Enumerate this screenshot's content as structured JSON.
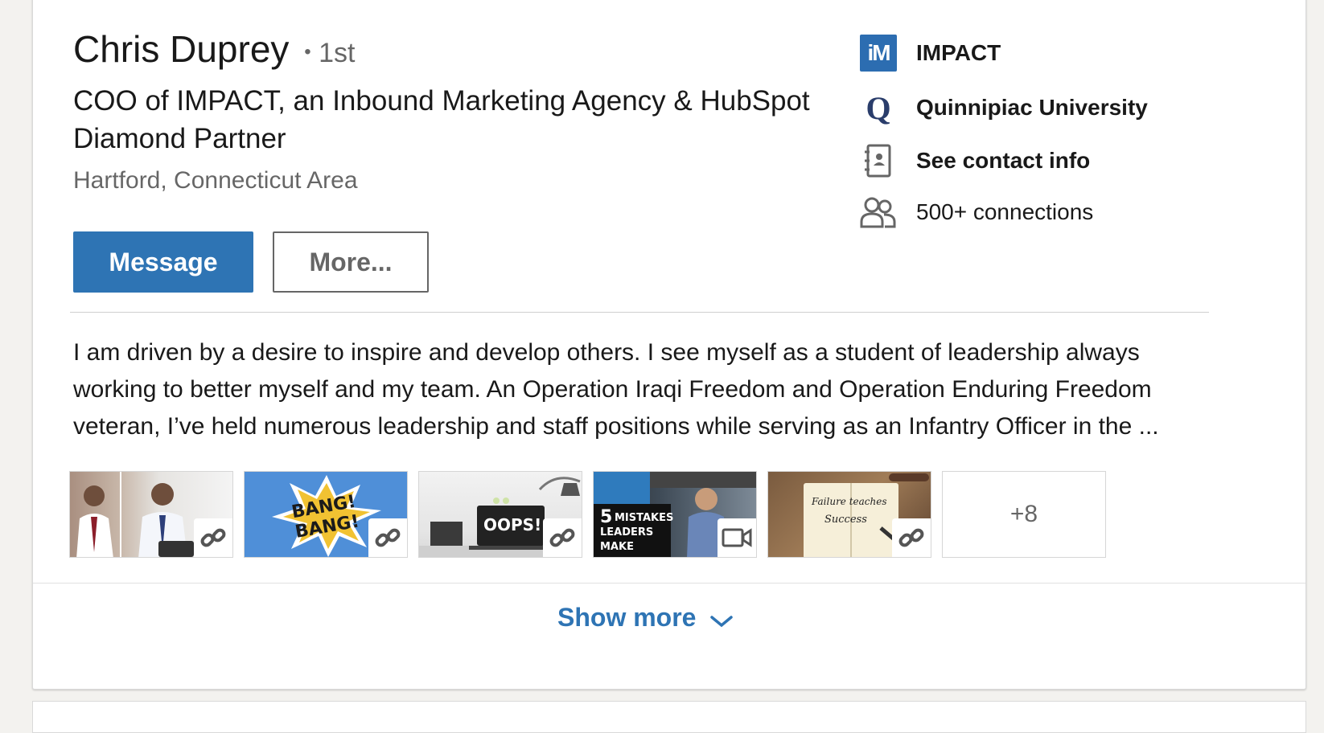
{
  "profile": {
    "name": "Chris Duprey",
    "degree": "1st",
    "degree_dot": "•",
    "headline": "COO of IMPACT, an Inbound Marketing Agency & HubSpot Diamond Partner",
    "location": "Hartford, Connecticut Area"
  },
  "actions": {
    "message_label": "Message",
    "more_label": "More..."
  },
  "sidebar": {
    "company": "IMPACT",
    "company_logo_text": "iM",
    "school": "Quinnipiac University",
    "school_logo_text": "Q",
    "contact": "See contact info",
    "connections": "500+ connections"
  },
  "summary": {
    "text": "I am driven by a desire to inspire and develop others. I see myself as a student of leadership always working to better myself and my team. An Operation Iraqi Freedom and Operation Enduring Freedom veteran, I’ve held numerous leadership and staff positions while serving as an Infantry Officer in the ..."
  },
  "media": {
    "items": [
      {
        "badge": "link-icon"
      },
      {
        "badge": "link-icon",
        "text": "BANG! BANG!"
      },
      {
        "badge": "link-icon",
        "text": "OOPS!"
      },
      {
        "badge": "video-icon",
        "text_big": "5",
        "text": "MISTAKES",
        "text2": "LEADERS",
        "text3": "MAKE"
      },
      {
        "badge": "link-icon",
        "text": "Failure teaches",
        "text2": "Success"
      }
    ],
    "more_count": "+8"
  },
  "footer": {
    "show_more_label": "Show more"
  },
  "colors": {
    "primary_blue": "#2e74b4",
    "impact_blue": "#2c6db1"
  }
}
